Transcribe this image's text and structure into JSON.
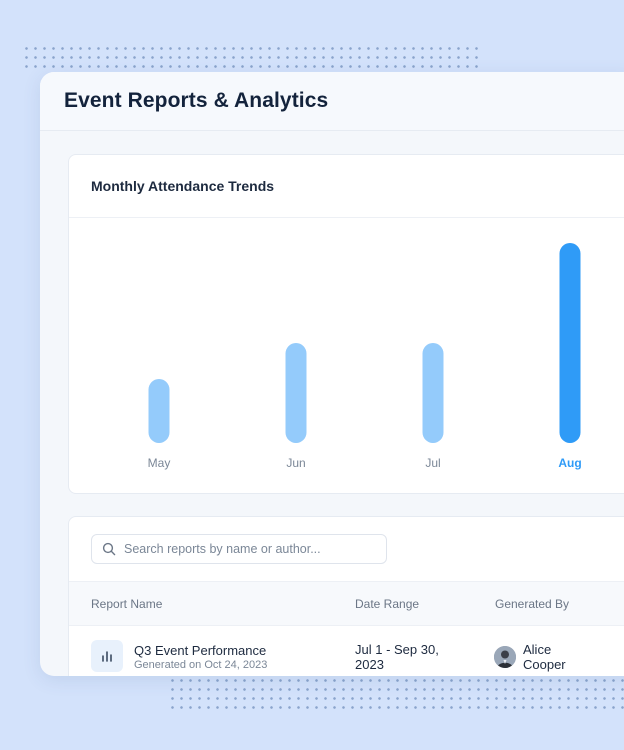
{
  "page": {
    "title": "Event Reports & Analytics"
  },
  "chart_card": {
    "title": "Monthly Attendance Trends"
  },
  "chart_data": {
    "type": "bar",
    "title": "Monthly Attendance Trends",
    "categories": [
      "May",
      "Jun",
      "Jul",
      "Aug"
    ],
    "values": [
      32,
      50,
      50,
      100
    ],
    "ylim": [
      0,
      100
    ],
    "grid": false,
    "highlighted_category": "Aug",
    "colors": {
      "bar": "#94cbfb",
      "bar_highlight": "#2f9bf7",
      "label": "#7b8797",
      "label_highlight": "#2f9bf7"
    }
  },
  "search": {
    "placeholder": "Search reports by name or author..."
  },
  "table": {
    "columns": [
      "Report Name",
      "Date Range",
      "Generated By"
    ],
    "rows": [
      {
        "name": "Q3 Event Performance",
        "subtitle": "Generated on Oct 24, 2023",
        "date_range": "Jul 1 - Sep 30, 2023",
        "author": "Alice Cooper",
        "icon": "bar-chart-icon"
      }
    ]
  }
}
